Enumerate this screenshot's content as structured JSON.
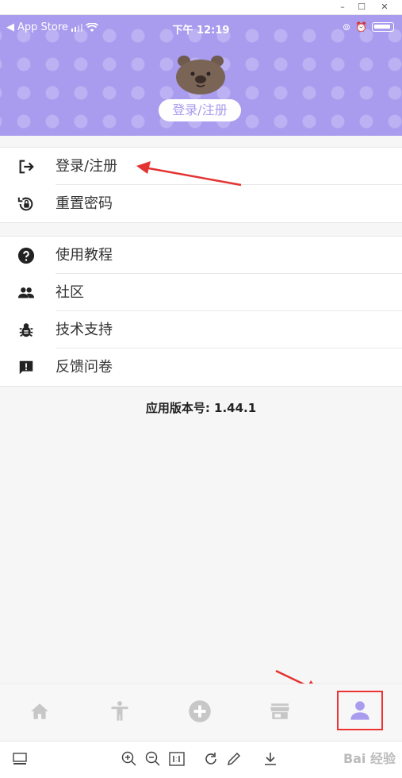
{
  "status_bar": {
    "carrier": "App Store",
    "time": "下午 12:19"
  },
  "profile": {
    "login_label": "登录/注册"
  },
  "menu_group_1": [
    {
      "label": "登录/注册",
      "icon": "logout-icon"
    },
    {
      "label": "重置密码",
      "icon": "lock-reset-icon"
    }
  ],
  "menu_group_2": [
    {
      "label": "使用教程",
      "icon": "help-icon"
    },
    {
      "label": "社区",
      "icon": "people-icon"
    },
    {
      "label": "技术支持",
      "icon": "bug-icon"
    },
    {
      "label": "反馈问卷",
      "icon": "feedback-icon"
    }
  ],
  "version_text": "应用版本号: 1.44.1",
  "tabs": [
    {
      "name": "home",
      "icon": "home-icon",
      "active": false
    },
    {
      "name": "accessibility",
      "icon": "accessibility-icon",
      "active": false
    },
    {
      "name": "add",
      "icon": "add-circle-icon",
      "active": false
    },
    {
      "name": "store",
      "icon": "store-icon",
      "active": false
    },
    {
      "name": "profile",
      "icon": "person-icon",
      "active": true
    }
  ],
  "colors": {
    "header": "#a99bee",
    "accent": "#a99bee",
    "annotation": "#e33333",
    "tab_inactive": "#c7c7c7"
  },
  "watermark": "Bai 经验"
}
